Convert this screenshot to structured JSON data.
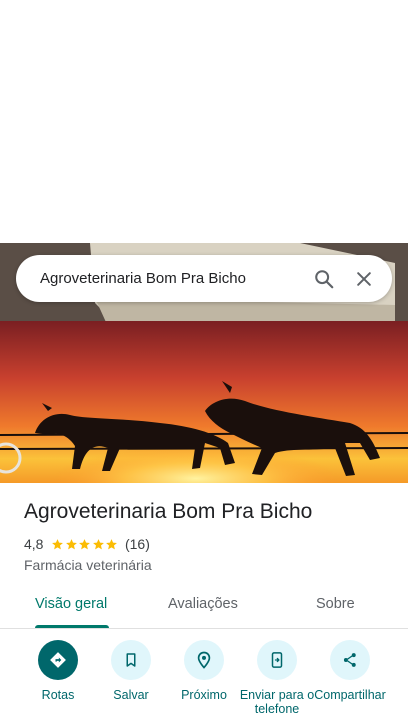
{
  "search": {
    "query": "Agroveterinaria Bom Pra Bicho"
  },
  "place": {
    "name": "Agroveterinaria Bom Pra Bicho",
    "rating": "4,8",
    "rating_stars": 5,
    "review_count": "(16)",
    "category": "Farmácia veterinária"
  },
  "tabs": [
    {
      "label": "Visão geral",
      "active": true
    },
    {
      "label": "Avaliações",
      "active": false
    },
    {
      "label": "Sobre",
      "active": false
    }
  ],
  "actions": [
    {
      "label": "Rotas",
      "icon": "directions-icon"
    },
    {
      "label": "Salvar",
      "icon": "bookmark-icon"
    },
    {
      "label": "Próximo",
      "icon": "nearby-icon"
    },
    {
      "label": "Enviar para o telefone",
      "icon": "send-to-phone-icon"
    },
    {
      "label": "Compartilhar",
      "icon": "share-icon"
    }
  ],
  "colors": {
    "accent": "#00676b",
    "star": "#fbbc04",
    "tab_active": "#00796b",
    "chip_bg": "#e0f6fb"
  }
}
